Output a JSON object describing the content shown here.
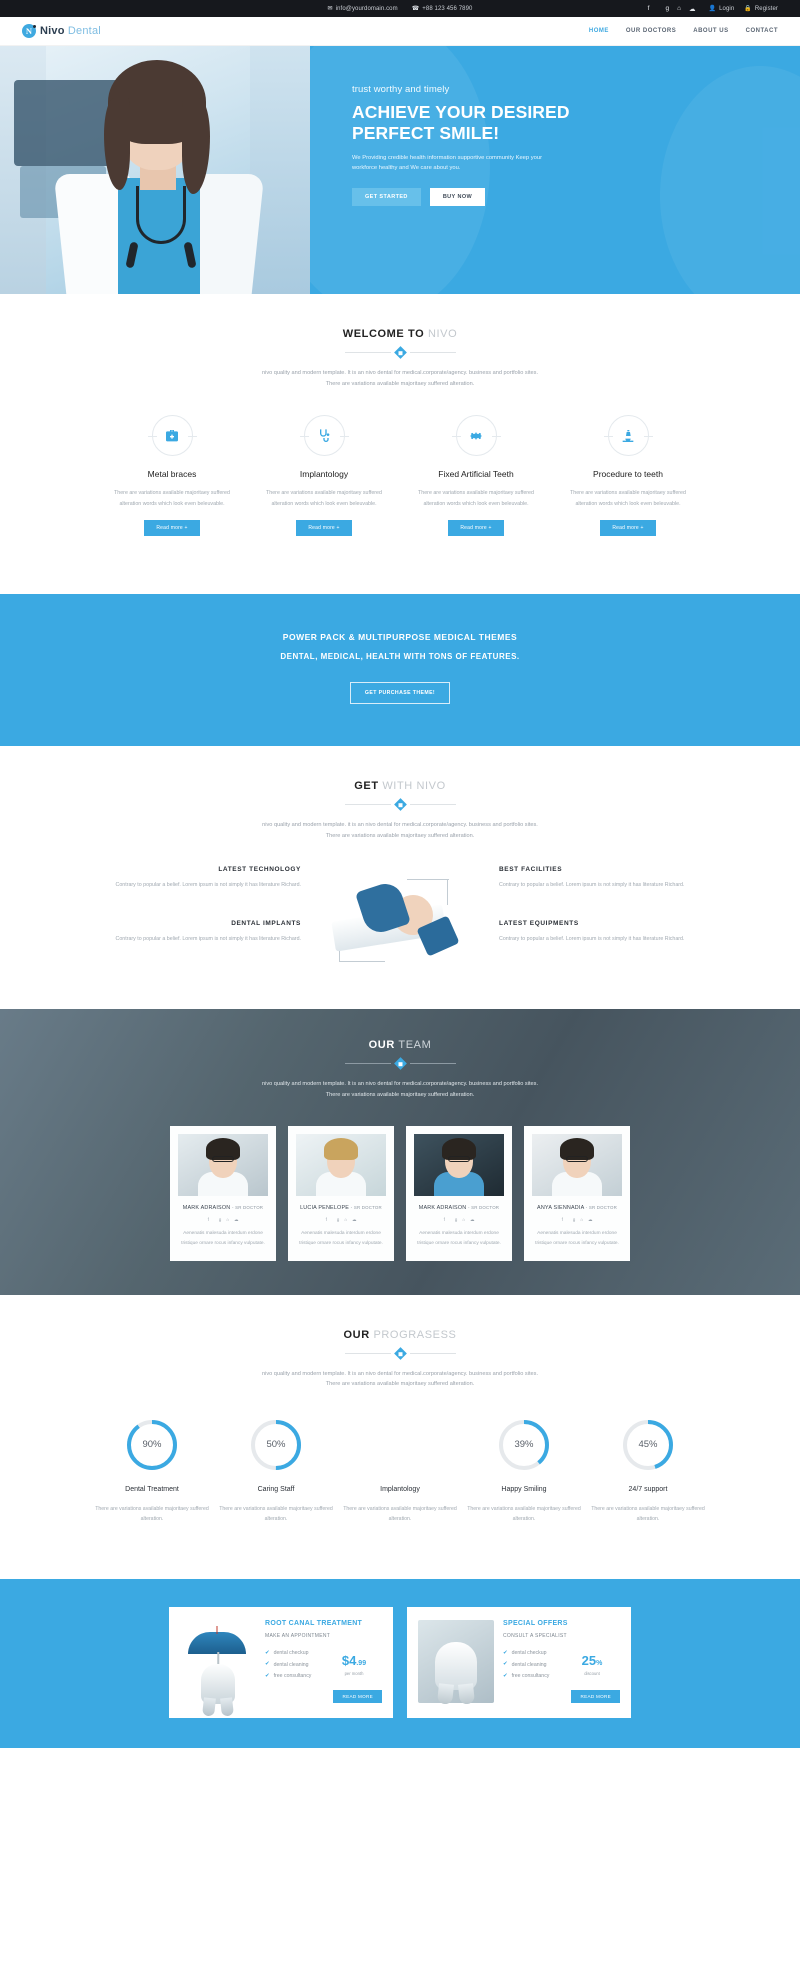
{
  "topbar": {
    "email": "info@yourdomain.com",
    "phone": "+88 123 456 7890",
    "email_icon": "envelope-icon",
    "phone_icon": "phone-icon",
    "social": [
      "facebook-icon",
      "twitter-icon",
      "google-plus-icon",
      "linkedin-icon",
      "rss-icon"
    ],
    "login": "Login",
    "register": "Register"
  },
  "header": {
    "logo_mark": "N",
    "logo_bold": "Nivo",
    "logo_light": "Dental",
    "nav": [
      {
        "label": "HOME",
        "active": true
      },
      {
        "label": "OUR DOCTORS",
        "active": false
      },
      {
        "label": "ABOUT US",
        "active": false
      },
      {
        "label": "CONTACT",
        "active": false
      }
    ]
  },
  "hero": {
    "supertitle": "trust worthy and timely",
    "title_line1": "ACHIEVE YOUR DESIRED",
    "title_line2": "PERFECT SMILE!",
    "paragraph": "We Providing credible health information supportive community Keep your workforce healthy and We care about you.",
    "btn_primary": "GET STARTED",
    "btn_secondary": "BUY NOW"
  },
  "welcome": {
    "title_bold": "WELCOME TO",
    "title_light": "NIVO",
    "subtitle_line1": "nivo quality and modern template. It is an nivo dental for medical.corporate/agency. business and portfolio sites.",
    "subtitle_line2": "There are variations available majoritaey suffered alteration.",
    "read_more": "Read more +",
    "services": [
      {
        "icon": "medical-kit-icon",
        "title": "Metal braces",
        "desc": "There are variations available majoritaey suffered alteration words which look even beleuvable."
      },
      {
        "icon": "stethoscope-icon",
        "title": "Implantology",
        "desc": "There are variations available majoritaey suffered alteration words which look even beleuvable."
      },
      {
        "icon": "gear-icon",
        "title": "Fixed Artificial Teeth",
        "desc": "There are variations available majoritaey suffered alteration words which look even beleuvable."
      },
      {
        "icon": "microscope-icon",
        "title": "Procedure to teeth",
        "desc": "There are variations available majoritaey suffered alteration words which look even beleuvable."
      }
    ]
  },
  "cta": {
    "line1": "POWER PACK & MULTIPURPOSE MEDICAL THEMES",
    "line2": "DENTAL, MEDICAL, HEALTH WITH TONS OF FEATURES.",
    "button": "GET PURCHASE THEME!"
  },
  "getwith": {
    "title_bold": "GET",
    "title_light": "WITH NIVO",
    "subtitle_line1": "nivo quality and modern template. it is an nivo dental for medical.corporate/agency. business and portfolio sites.",
    "subtitle_line2": "There are variations available majoritaey suffered alteration.",
    "features_left": [
      {
        "title": "LATEST TECHNOLOGY",
        "desc": "Contrary to popular a belief. Lorem ipsum is not simply it has literature Richard."
      },
      {
        "title": "DENTAL IMPLANTS",
        "desc": "Contrary to popular a belief. Lorem ipsum is not simply it has literature Richard."
      }
    ],
    "features_right": [
      {
        "title": "BEST FACILITIES",
        "desc": "Contrary to popular a belief. Lorem ipsum is not simply it has literature Richard."
      },
      {
        "title": "LATEST EQUIPMENTS",
        "desc": "Contrary to popular a belief. Lorem ipsum is not simply it has literature Richard."
      }
    ]
  },
  "team": {
    "title_bold": "OUR",
    "title_light": "TEAM",
    "subtitle_line1": "nivo quality and modern template. It is an nivo dental for medical.corporate/agency. business and portfolio sites.",
    "subtitle_line2": "There are variations available majoritaey suffered alteration.",
    "social_icons": [
      "facebook-icon",
      "twitter-icon",
      "google-plus-icon",
      "linkedin-icon",
      "rss-icon"
    ],
    "members": [
      {
        "name": "MARK ADRAISON",
        "role": "- SR DOCTOR",
        "bio": "Aenenatis malesuda interdum erdone tristique ornare rocus infancy vulputate."
      },
      {
        "name": "LUCIA PENELOPE",
        "role": "- SR DOCTOR",
        "bio": "Aenenatis malesuda interdum erdone tristique ornare rocus infancy vulputate."
      },
      {
        "name": "MARK ADRAISON",
        "role": "- SR DOCTOR",
        "bio": "Aenenatis malesuda interdum erdone tristique ornare rocus infancy vulputate."
      },
      {
        "name": "ANYA SIENNADIA",
        "role": "- SR DOCTOR",
        "bio": "Aenenatis malesuda interdum erdone tristique ornare rocus infancy vulputate."
      }
    ]
  },
  "progress": {
    "title_bold": "OUR",
    "title_light": "PROGRASESS",
    "subtitle_line1": "nivo quality and modern template. It is an nivo dental for medical.corporate/agency. business and portfolio sites.",
    "subtitle_line2": "There are variations available majoritaey suffered alteration.",
    "accent_color": "#3ba9e2",
    "track_color": "#e6e9ec",
    "items": [
      {
        "label": "Dental Treatment",
        "value": "90%",
        "percent": 90,
        "visible": true,
        "desc": "There are variations available majoritaey suffered alteration."
      },
      {
        "label": "Caring Staff",
        "value": "50%",
        "percent": 50,
        "visible": true,
        "desc": "There are variations available majoritaey suffered alteration."
      },
      {
        "label": "Implantology",
        "value": "",
        "percent": 0,
        "visible": false,
        "desc": "There are variations available majoritaey suffered alteration."
      },
      {
        "label": "Happy Smiling",
        "value": "39%",
        "percent": 39,
        "visible": true,
        "desc": "There are variations available majoritaey suffered alteration."
      },
      {
        "label": "24/7 support",
        "value": "45%",
        "percent": 45,
        "visible": true,
        "desc": "There are variations available majoritaey suffered alteration."
      }
    ]
  },
  "pricing": {
    "cards": [
      {
        "title": "ROOT CANAL TREATMENT",
        "subtitle": "MAKE AN APPOINTMENT",
        "features": [
          "dental checkup",
          "dental cleaning",
          "free consultancy"
        ],
        "price_currency": "$",
        "price_main": "4",
        "price_cents": ".99",
        "price_per": "per month",
        "button": "READ MORE",
        "image": "umbrella-tooth-icon"
      },
      {
        "title": "SPECIAL OFFERS",
        "subtitle": "CONSULT A SPECIALIST",
        "features": [
          "dental checkup",
          "dental cleaning",
          "free consultancy"
        ],
        "discount_value": "25",
        "discount_symbol": "%",
        "discount_label": "discount",
        "button": "READ MORE",
        "image": "tooth-photo"
      }
    ]
  }
}
